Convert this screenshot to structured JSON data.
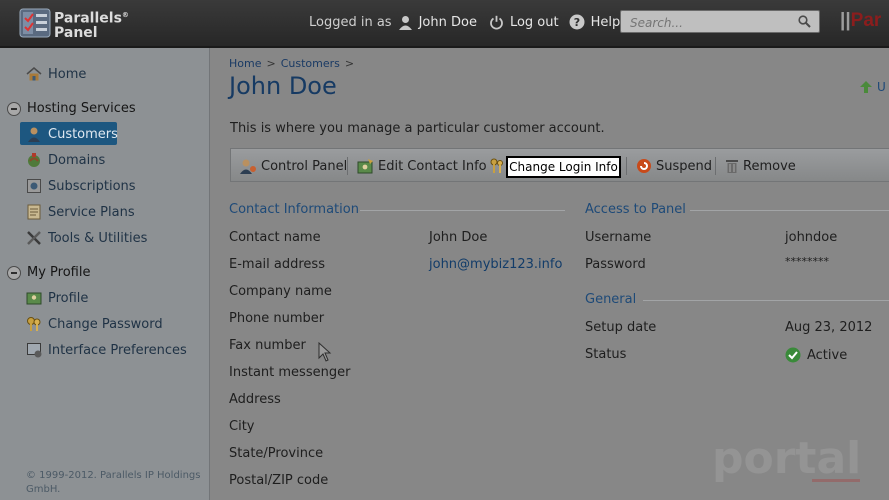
{
  "header": {
    "logo_line1": "Parallels",
    "logo_sup": "®",
    "logo_line2": "Panel",
    "logged_in_label": "Logged in as",
    "user_name": "John Doe",
    "logout_label": "Log out",
    "help_label": "Help",
    "search_placeholder": "Search...",
    "brand_par": "Par"
  },
  "sidebar": {
    "home": "Home",
    "hosting_services": "Hosting Services",
    "items": [
      {
        "label": "Customers",
        "icon": "customers-icon"
      },
      {
        "label": "Domains",
        "icon": "domains-icon"
      },
      {
        "label": "Subscriptions",
        "icon": "subscriptions-icon"
      },
      {
        "label": "Service Plans",
        "icon": "service-plans-icon"
      },
      {
        "label": "Tools & Utilities",
        "icon": "tools-icon"
      }
    ],
    "my_profile": "My Profile",
    "profile_items": [
      {
        "label": "Profile",
        "icon": "profile-icon"
      },
      {
        "label": "Change Password",
        "icon": "keys-icon"
      },
      {
        "label": "Interface Preferences",
        "icon": "interface-icon"
      }
    ],
    "footer": "© 1999-2012. Parallels IP Holdings GmbH."
  },
  "main": {
    "breadcrumb": [
      "Home",
      "Customers"
    ],
    "title": "John Doe",
    "description": "This is where you manage a particular customer account.",
    "upload_label": "U",
    "toolbar": {
      "control_panel": "Control Panel",
      "edit_contact": "Edit Contact Info",
      "change_login": "Change Login Info",
      "suspend": "Suspend",
      "remove": "Remove"
    },
    "contact": {
      "title": "Contact Information",
      "fields": [
        {
          "label": "Contact name",
          "value": "John Doe"
        },
        {
          "label": "E-mail address",
          "value": "john@mybiz123.info"
        },
        {
          "label": "Company name",
          "value": ""
        },
        {
          "label": "Phone number",
          "value": ""
        },
        {
          "label": "Fax number",
          "value": ""
        },
        {
          "label": "Instant messenger",
          "value": ""
        },
        {
          "label": "Address",
          "value": ""
        },
        {
          "label": "City",
          "value": ""
        },
        {
          "label": "State/Province",
          "value": ""
        },
        {
          "label": "Postal/ZIP code",
          "value": ""
        }
      ]
    },
    "access": {
      "title": "Access to Panel",
      "username_label": "Username",
      "username": "johndoe",
      "password_label": "Password",
      "password": "********"
    },
    "general": {
      "title": "General",
      "setup_label": "Setup date",
      "setup_date": "Aug 23, 2012",
      "status_label": "Status",
      "status": "Active"
    },
    "watermark_text": "portal"
  },
  "colors": {
    "accent": "#1d5780",
    "link": "#123c69",
    "brand_red": "#8b1d1d"
  }
}
